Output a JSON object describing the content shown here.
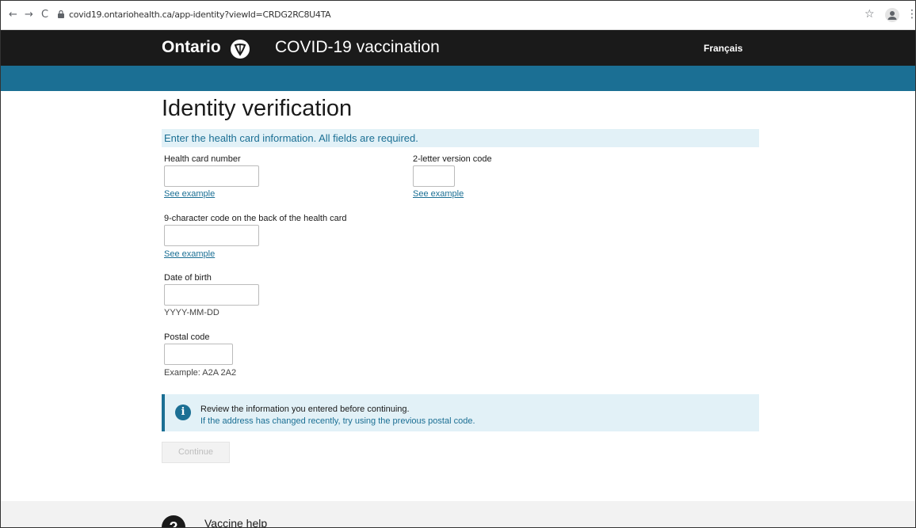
{
  "browser": {
    "url": "covid19.ontariohealth.ca/app-identity?viewId=CRDG2RC8U4TA",
    "back_icon": "←",
    "forward_icon": "→",
    "reload_icon": "C",
    "star_icon": "☆",
    "menu_icon": "⋮"
  },
  "header": {
    "brand": "Ontario",
    "title": "COVID-19 vaccination",
    "language_link": "Français"
  },
  "page": {
    "heading": "Identity verification",
    "instructions": "Enter the health card information. All fields are required."
  },
  "form": {
    "health_card": {
      "label": "Health card number",
      "value": "",
      "example_link": "See example"
    },
    "version_code": {
      "label": "2-letter version code",
      "value": "",
      "example_link": "See example"
    },
    "back_code": {
      "label": "9-character code on the back of the health card",
      "value": "",
      "example_link": "See example"
    },
    "dob": {
      "label": "Date of birth",
      "value": "",
      "hint": "YYYY-MM-DD"
    },
    "postal": {
      "label": "Postal code",
      "value": "",
      "hint": "Example: A2A 2A2"
    }
  },
  "info": {
    "icon": "i",
    "title": "Review the information you entered before continuing.",
    "body": "If the address has changed recently, try using the previous postal code."
  },
  "actions": {
    "continue_label": "Continue"
  },
  "footer": {
    "help_icon": "?",
    "help_title": "Vaccine help"
  }
}
